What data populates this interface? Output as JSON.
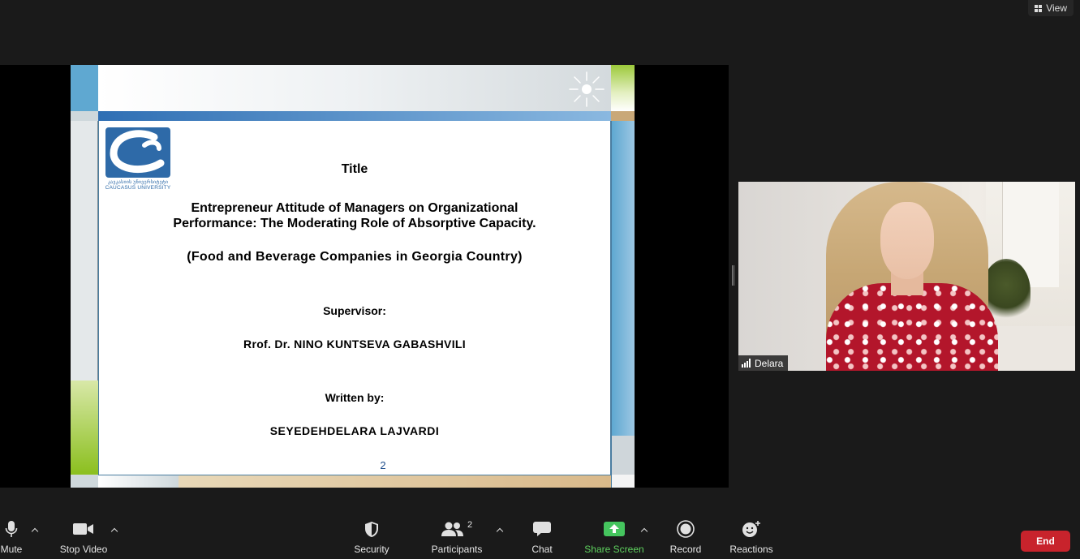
{
  "top_bar": {
    "view_label": "View",
    "view_icon": "grid-icon"
  },
  "slide": {
    "logo_text_ka": "კავკასიის უნივერსიტეტი",
    "logo_text_en": "CAUCASUS UNIVERSITY",
    "title": "Title",
    "main_title": "Entrepreneur Attitude of Managers on Organizational Performance: The Moderating Role of Absorptive Capacity.",
    "subtitle": "(Food and Beverage Companies in Georgia Country)",
    "supervisor_label": "Supervisor:",
    "supervisor_name": "Rrof. Dr. NINO KUNTSEVA GABASHVILI",
    "written_by_label": "Written by:",
    "author_name": "SEYEDEHDELARA LAJVARDI",
    "page_number": "2"
  },
  "participant": {
    "name": "Delara",
    "signal_icon": "signal-bars-icon"
  },
  "toolbar": {
    "mute_label": "Mute",
    "stop_video_label": "Stop Video",
    "security_label": "Security",
    "participants_label": "Participants",
    "participants_count": "2",
    "chat_label": "Chat",
    "share_screen_label": "Share Screen",
    "record_label": "Record",
    "reactions_label": "Reactions",
    "end_label": "End"
  },
  "colors": {
    "share_green": "#5ed15e",
    "end_red": "#c8232c",
    "background": "#1a1a1a"
  }
}
